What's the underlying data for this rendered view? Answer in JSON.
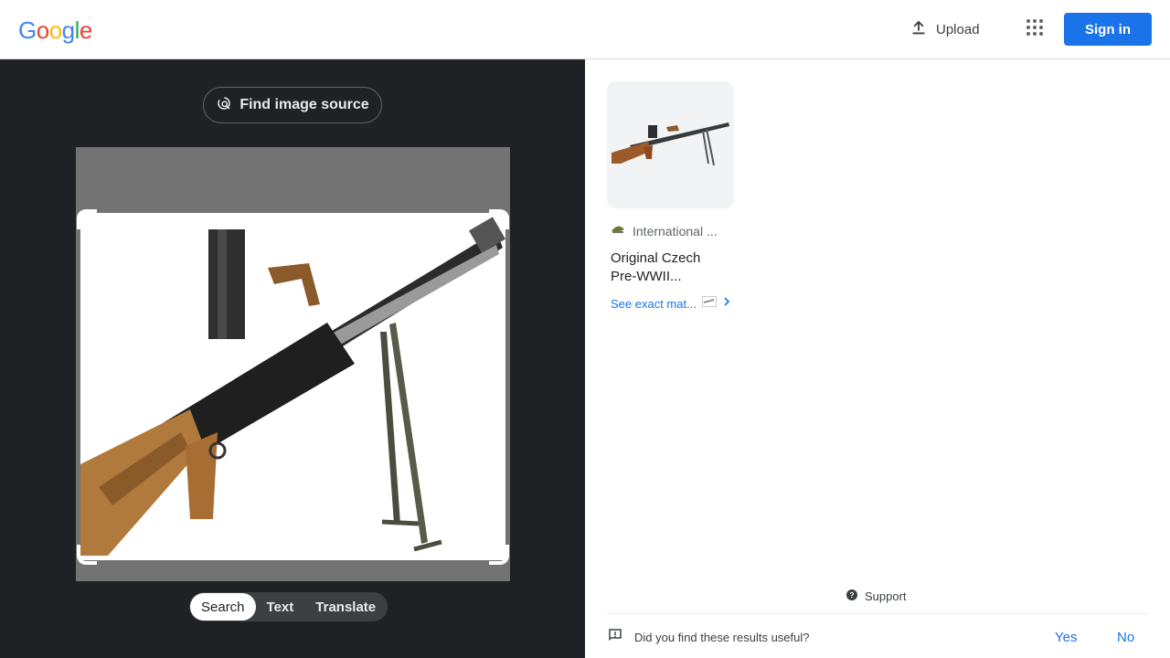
{
  "header": {
    "logo_text": "Google",
    "upload_label": "Upload",
    "signin_label": "Sign in",
    "brand_colors": [
      "#4285f4",
      "#ea4335",
      "#fbbc05",
      "#4285f4",
      "#34a853",
      "#ea4335"
    ]
  },
  "lens": {
    "find_source_label": "Find image source",
    "modes": [
      {
        "label": "Search",
        "active": true
      },
      {
        "label": "Text",
        "active": false
      },
      {
        "label": "Translate",
        "active": false
      }
    ]
  },
  "results": [
    {
      "source": "International ...",
      "title_line1": "Original Czech",
      "title_line2": "Pre-WWII...",
      "exact_match_label": "See exact mat..."
    }
  ],
  "footer": {
    "support_label": "Support",
    "feedback_question": "Did you find these results useful?",
    "yes_label": "Yes",
    "no_label": "No"
  },
  "colors": {
    "accent": "#1a73e8",
    "dark_pane": "#202124"
  }
}
